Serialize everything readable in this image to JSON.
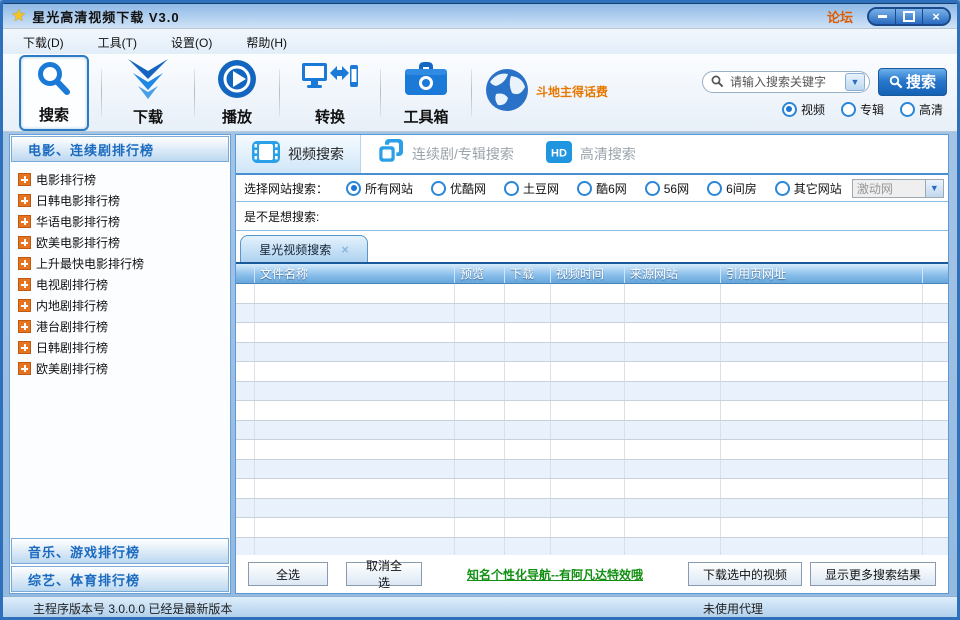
{
  "window": {
    "title": "星光高清视频下载 V3.0",
    "forum_link": "论坛"
  },
  "menu": {
    "items": [
      {
        "label": "下载(D)"
      },
      {
        "label": "工具(T)"
      },
      {
        "label": "设置(O)"
      },
      {
        "label": "帮助(H)"
      }
    ]
  },
  "toolbar": {
    "buttons": [
      {
        "label": "搜索",
        "icon": "magnifier-icon",
        "active": true
      },
      {
        "label": "下载",
        "icon": "download-chevrons-icon",
        "active": false
      },
      {
        "label": "播放",
        "icon": "play-circle-icon",
        "active": false
      },
      {
        "label": "转换",
        "icon": "convert-devices-icon",
        "active": false
      },
      {
        "label": "工具箱",
        "icon": "toolbox-icon",
        "active": false
      }
    ],
    "promo": {
      "icon": "globe-icon",
      "text": "斗地主得话费"
    },
    "search": {
      "placeholder": "请输入搜索关键字",
      "button_label": "搜索",
      "scopes": [
        {
          "label": "视频",
          "selected": true
        },
        {
          "label": "专辑",
          "selected": false
        },
        {
          "label": "高清",
          "selected": false
        }
      ]
    }
  },
  "sidebar": {
    "sections": [
      {
        "title": "电影、连续剧排行榜",
        "expanded": true,
        "items": [
          "电影排行榜",
          "日韩电影排行榜",
          "华语电影排行榜",
          "欧美电影排行榜",
          "上升最快电影排行榜",
          "电视剧排行榜",
          "内地剧排行榜",
          "港台剧排行榜",
          "日韩剧排行榜",
          "欧美剧排行榜"
        ]
      },
      {
        "title": "音乐、游戏排行榜",
        "expanded": false,
        "items": []
      },
      {
        "title": "综艺、体育排行榜",
        "expanded": false,
        "items": []
      }
    ]
  },
  "main": {
    "tabs": [
      {
        "label": "视频搜索",
        "icon": "film-icon",
        "active": true
      },
      {
        "label": "连续剧/专辑搜索",
        "icon": "albums-icon",
        "active": false
      },
      {
        "label": "高清搜索",
        "icon": "hd-icon",
        "active": false
      }
    ],
    "site_filter": {
      "label": "选择网站搜索：",
      "options": [
        {
          "label": "所有网站",
          "selected": true
        },
        {
          "label": "优酷网",
          "selected": false
        },
        {
          "label": "土豆网",
          "selected": false
        },
        {
          "label": "酷6网",
          "selected": false
        },
        {
          "label": "56网",
          "selected": false
        },
        {
          "label": "6间房",
          "selected": false
        },
        {
          "label": "其它网站",
          "selected": false
        }
      ],
      "other_site_dropdown": {
        "value": "激动网",
        "disabled": true
      }
    },
    "suggest_label": "是不是想搜索:",
    "result_tab": {
      "label": "星光视频搜索",
      "close": "×"
    },
    "table": {
      "columns": [
        "文件名称",
        "预览",
        "下载",
        "视频时间",
        "来源网站",
        "引用页网址"
      ],
      "empty_rows": 14
    },
    "footer": {
      "select_all": "全选",
      "deselect_all": "取消全选",
      "promo_link": "知名个性化导航--有阿凡达特效哦",
      "download_selected": "下载选中的视频",
      "show_more": "显示更多搜索结果"
    }
  },
  "statusbar": {
    "left": "主程序版本号 3.0.0.0  已经是最新版本",
    "right": "未使用代理"
  },
  "colors": {
    "accent": "#1b7ad8",
    "orange": "#e87800",
    "link_green": "#129012",
    "header_blue": "#8cc0ea"
  }
}
